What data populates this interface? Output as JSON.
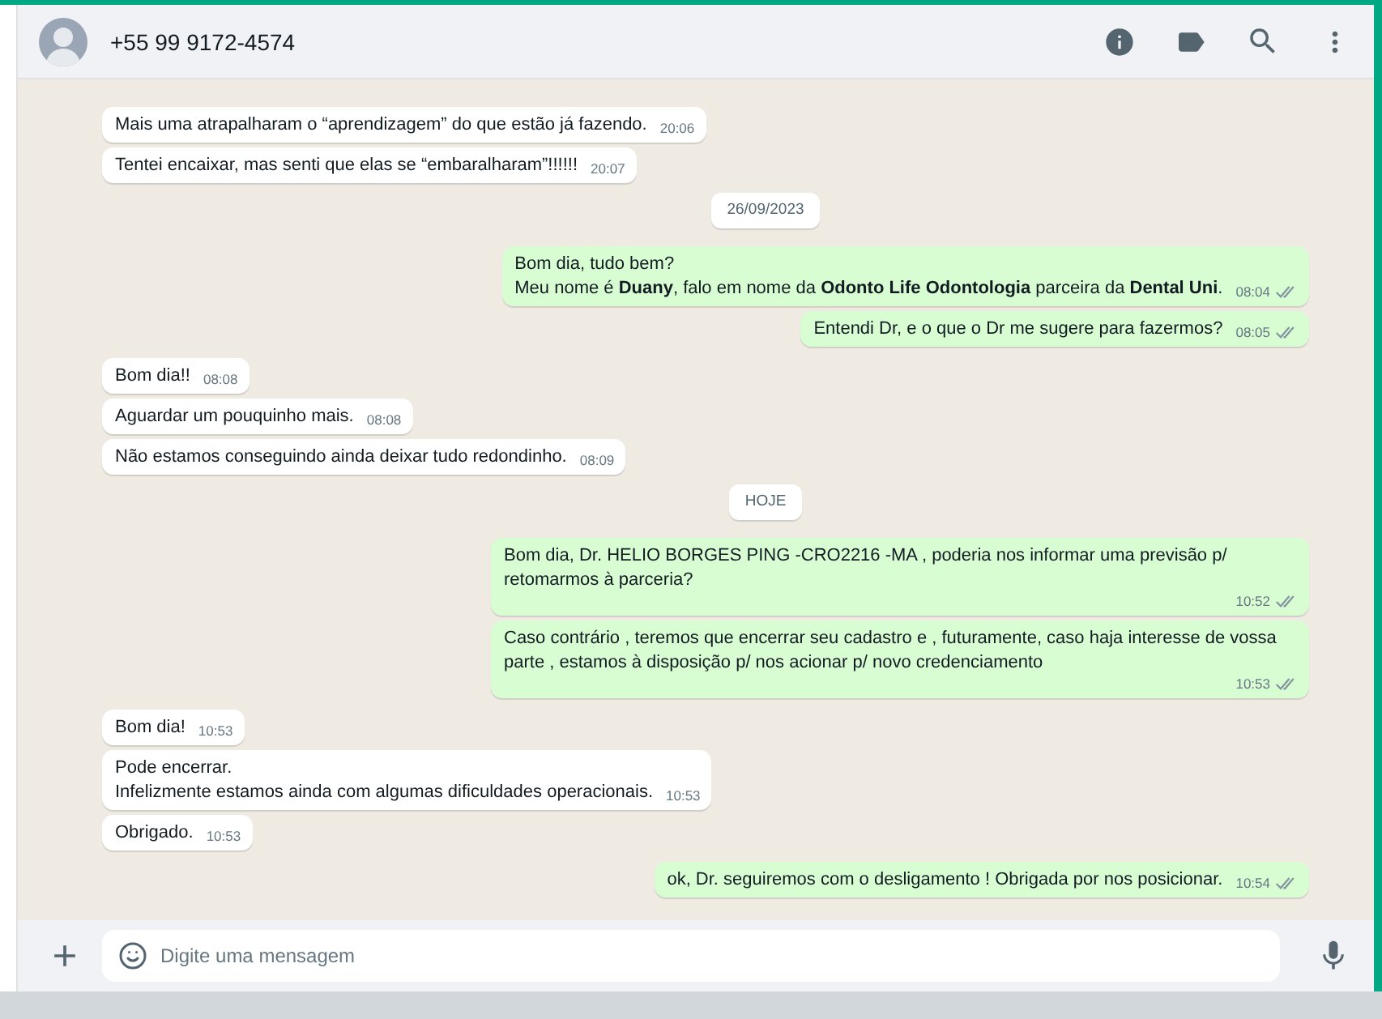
{
  "header": {
    "contact": "+55 99 9172-4574"
  },
  "messages": [
    {
      "kind": "message",
      "outgoing": false,
      "text": "Mais uma atrapalharam o “aprendizagem” do que estão já fazendo.",
      "time": "20:06"
    },
    {
      "kind": "message",
      "outgoing": false,
      "text": "Tentei encaixar, mas senti que elas se “embaralharam”!!!!!!",
      "time": "20:07"
    },
    {
      "kind": "date",
      "text": "26/09/2023"
    },
    {
      "kind": "message",
      "outgoing": true,
      "text": "Bom dia, tudo bem?\nMeu nome é **Duany**, falo em nome da **Odonto Life Odontologia** parceira da **Dental Uni**.",
      "time": "08:04",
      "read": false
    },
    {
      "kind": "message",
      "outgoing": true,
      "text": "Entendi Dr, e o que o Dr me sugere para fazermos?",
      "time": "08:05",
      "read": false
    },
    {
      "kind": "message",
      "outgoing": false,
      "text": "Bom dia!!",
      "time": "08:08"
    },
    {
      "kind": "message",
      "outgoing": false,
      "text": "Aguardar um pouquinho mais.",
      "time": "08:08"
    },
    {
      "kind": "message",
      "outgoing": false,
      "text": "Não estamos conseguindo ainda deixar tudo redondinho.",
      "time": "08:09"
    },
    {
      "kind": "date",
      "text": "HOJE"
    },
    {
      "kind": "message",
      "outgoing": true,
      "text": "Bom dia, Dr. HELIO BORGES PING -CRO2216 -MA , poderia nos informar uma previsão p/ retomarmos à parceria?",
      "time": "10:52",
      "read": false
    },
    {
      "kind": "message",
      "outgoing": true,
      "text": "Caso contrário , teremos que encerrar seu cadastro e , futuramente, caso haja interesse de vossa parte , estamos à disposição p/ nos acionar p/ novo credenciamento",
      "time": "10:53",
      "read": false
    },
    {
      "kind": "message",
      "outgoing": false,
      "text": "Bom dia!",
      "time": "10:53"
    },
    {
      "kind": "message",
      "outgoing": false,
      "text": "Pode encerrar.\nInfelizmente estamos ainda com algumas dificuldades operacionais.",
      "time": "10:53"
    },
    {
      "kind": "message",
      "outgoing": false,
      "text": "Obrigado.",
      "time": "10:53"
    },
    {
      "kind": "message",
      "outgoing": true,
      "text": "ok, Dr. seguiremos com o desligamento ! Obrigada por nos posicionar.",
      "time": "10:54",
      "read": false
    }
  ],
  "composer": {
    "placeholder": "Digite uma mensagem"
  }
}
